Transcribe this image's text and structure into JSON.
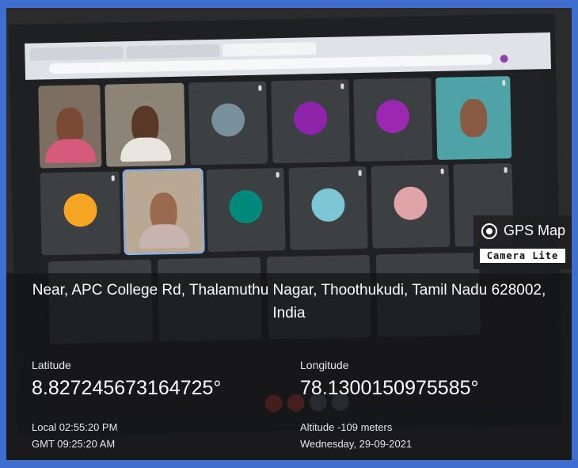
{
  "address": {
    "line1": "Near, APC College Rd, Thalamuthu Nagar, Thoothukudi, Tamil Nadu 628002,",
    "line2": "India"
  },
  "coordinates": {
    "latitude_label": "Latitude",
    "latitude_value": "8.827245673164725°",
    "longitude_label": "Longitude",
    "longitude_value": "78.1300150975585°"
  },
  "time": {
    "local": "Local 02:55:20 PM",
    "gmt": "GMT 09:25:20 AM"
  },
  "location_meta": {
    "altitude": "Altitude -109 meters",
    "date": "Wednesday, 29-09-2021"
  },
  "watermark": {
    "title": "GPS Map",
    "subtitle": "Camera Lite"
  },
  "colors": {
    "frame_border": "#3e6fd0",
    "avatar_t": "#78909c",
    "avatar_s": "#8e24aa",
    "avatar_p": "#9c27b0",
    "avatar_m": "#f6a623",
    "avatar_k": "#00897b"
  }
}
